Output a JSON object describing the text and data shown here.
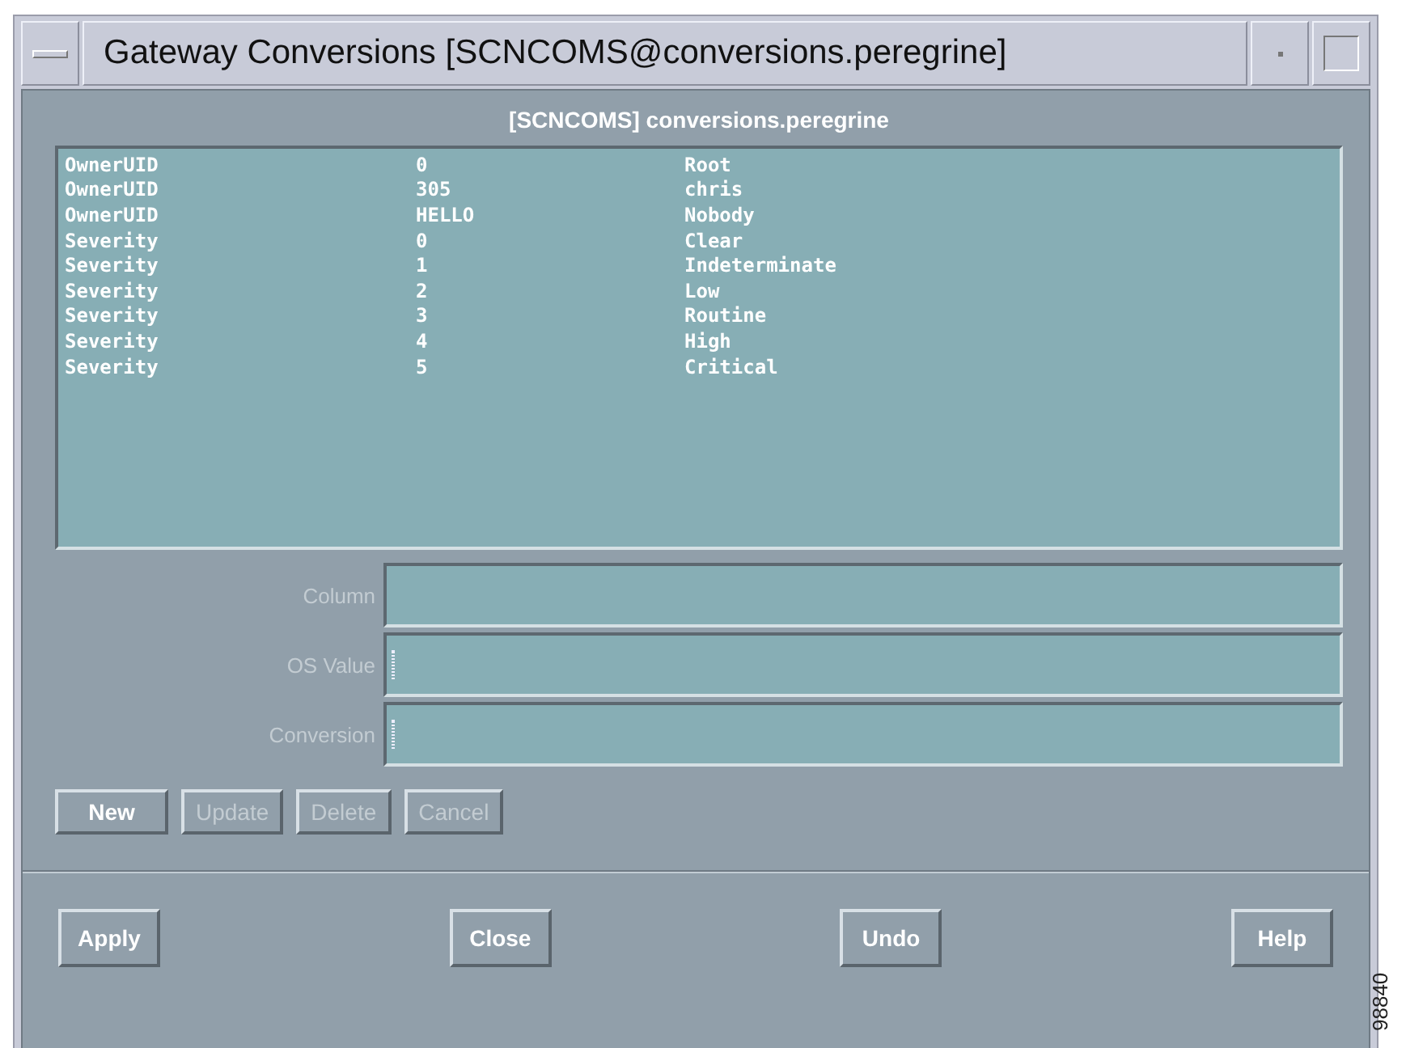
{
  "window": {
    "title": "Gateway Conversions [SCNCOMS@conversions.peregrine]"
  },
  "heading": "[SCNCOMS] conversions.peregrine",
  "list": {
    "rows": [
      {
        "cells": [
          "OwnerUID",
          "0",
          "Root"
        ]
      },
      {
        "cells": [
          "OwnerUID",
          "305",
          "chris"
        ]
      },
      {
        "cells": [
          "OwnerUID",
          "HELLO",
          "Nobody"
        ]
      },
      {
        "cells": [
          "Severity",
          "0",
          "Clear"
        ]
      },
      {
        "cells": [
          "Severity",
          "1",
          "Indeterminate"
        ]
      },
      {
        "cells": [
          "Severity",
          "2",
          "Low"
        ]
      },
      {
        "cells": [
          "Severity",
          "3",
          "Routine"
        ]
      },
      {
        "cells": [
          "Severity",
          "4",
          "High"
        ]
      },
      {
        "cells": [
          "Severity",
          "5",
          "Critical"
        ]
      }
    ]
  },
  "fields": [
    {
      "label": "Column",
      "disabled": true,
      "caret": false
    },
    {
      "label": "OS Value",
      "disabled": true,
      "caret": true
    },
    {
      "label": "Conversion",
      "disabled": true,
      "caret": true
    }
  ],
  "edit_buttons": [
    {
      "label": "New",
      "disabled": false
    },
    {
      "label": "Update",
      "disabled": true
    },
    {
      "label": "Delete",
      "disabled": true
    },
    {
      "label": "Cancel",
      "disabled": true
    }
  ],
  "dialog_buttons": [
    {
      "label": "Apply",
      "disabled": false
    },
    {
      "label": "Close",
      "disabled": false
    },
    {
      "label": "Undo",
      "disabled": false
    },
    {
      "label": "Help",
      "disabled": false
    }
  ],
  "figure_number": "98840"
}
